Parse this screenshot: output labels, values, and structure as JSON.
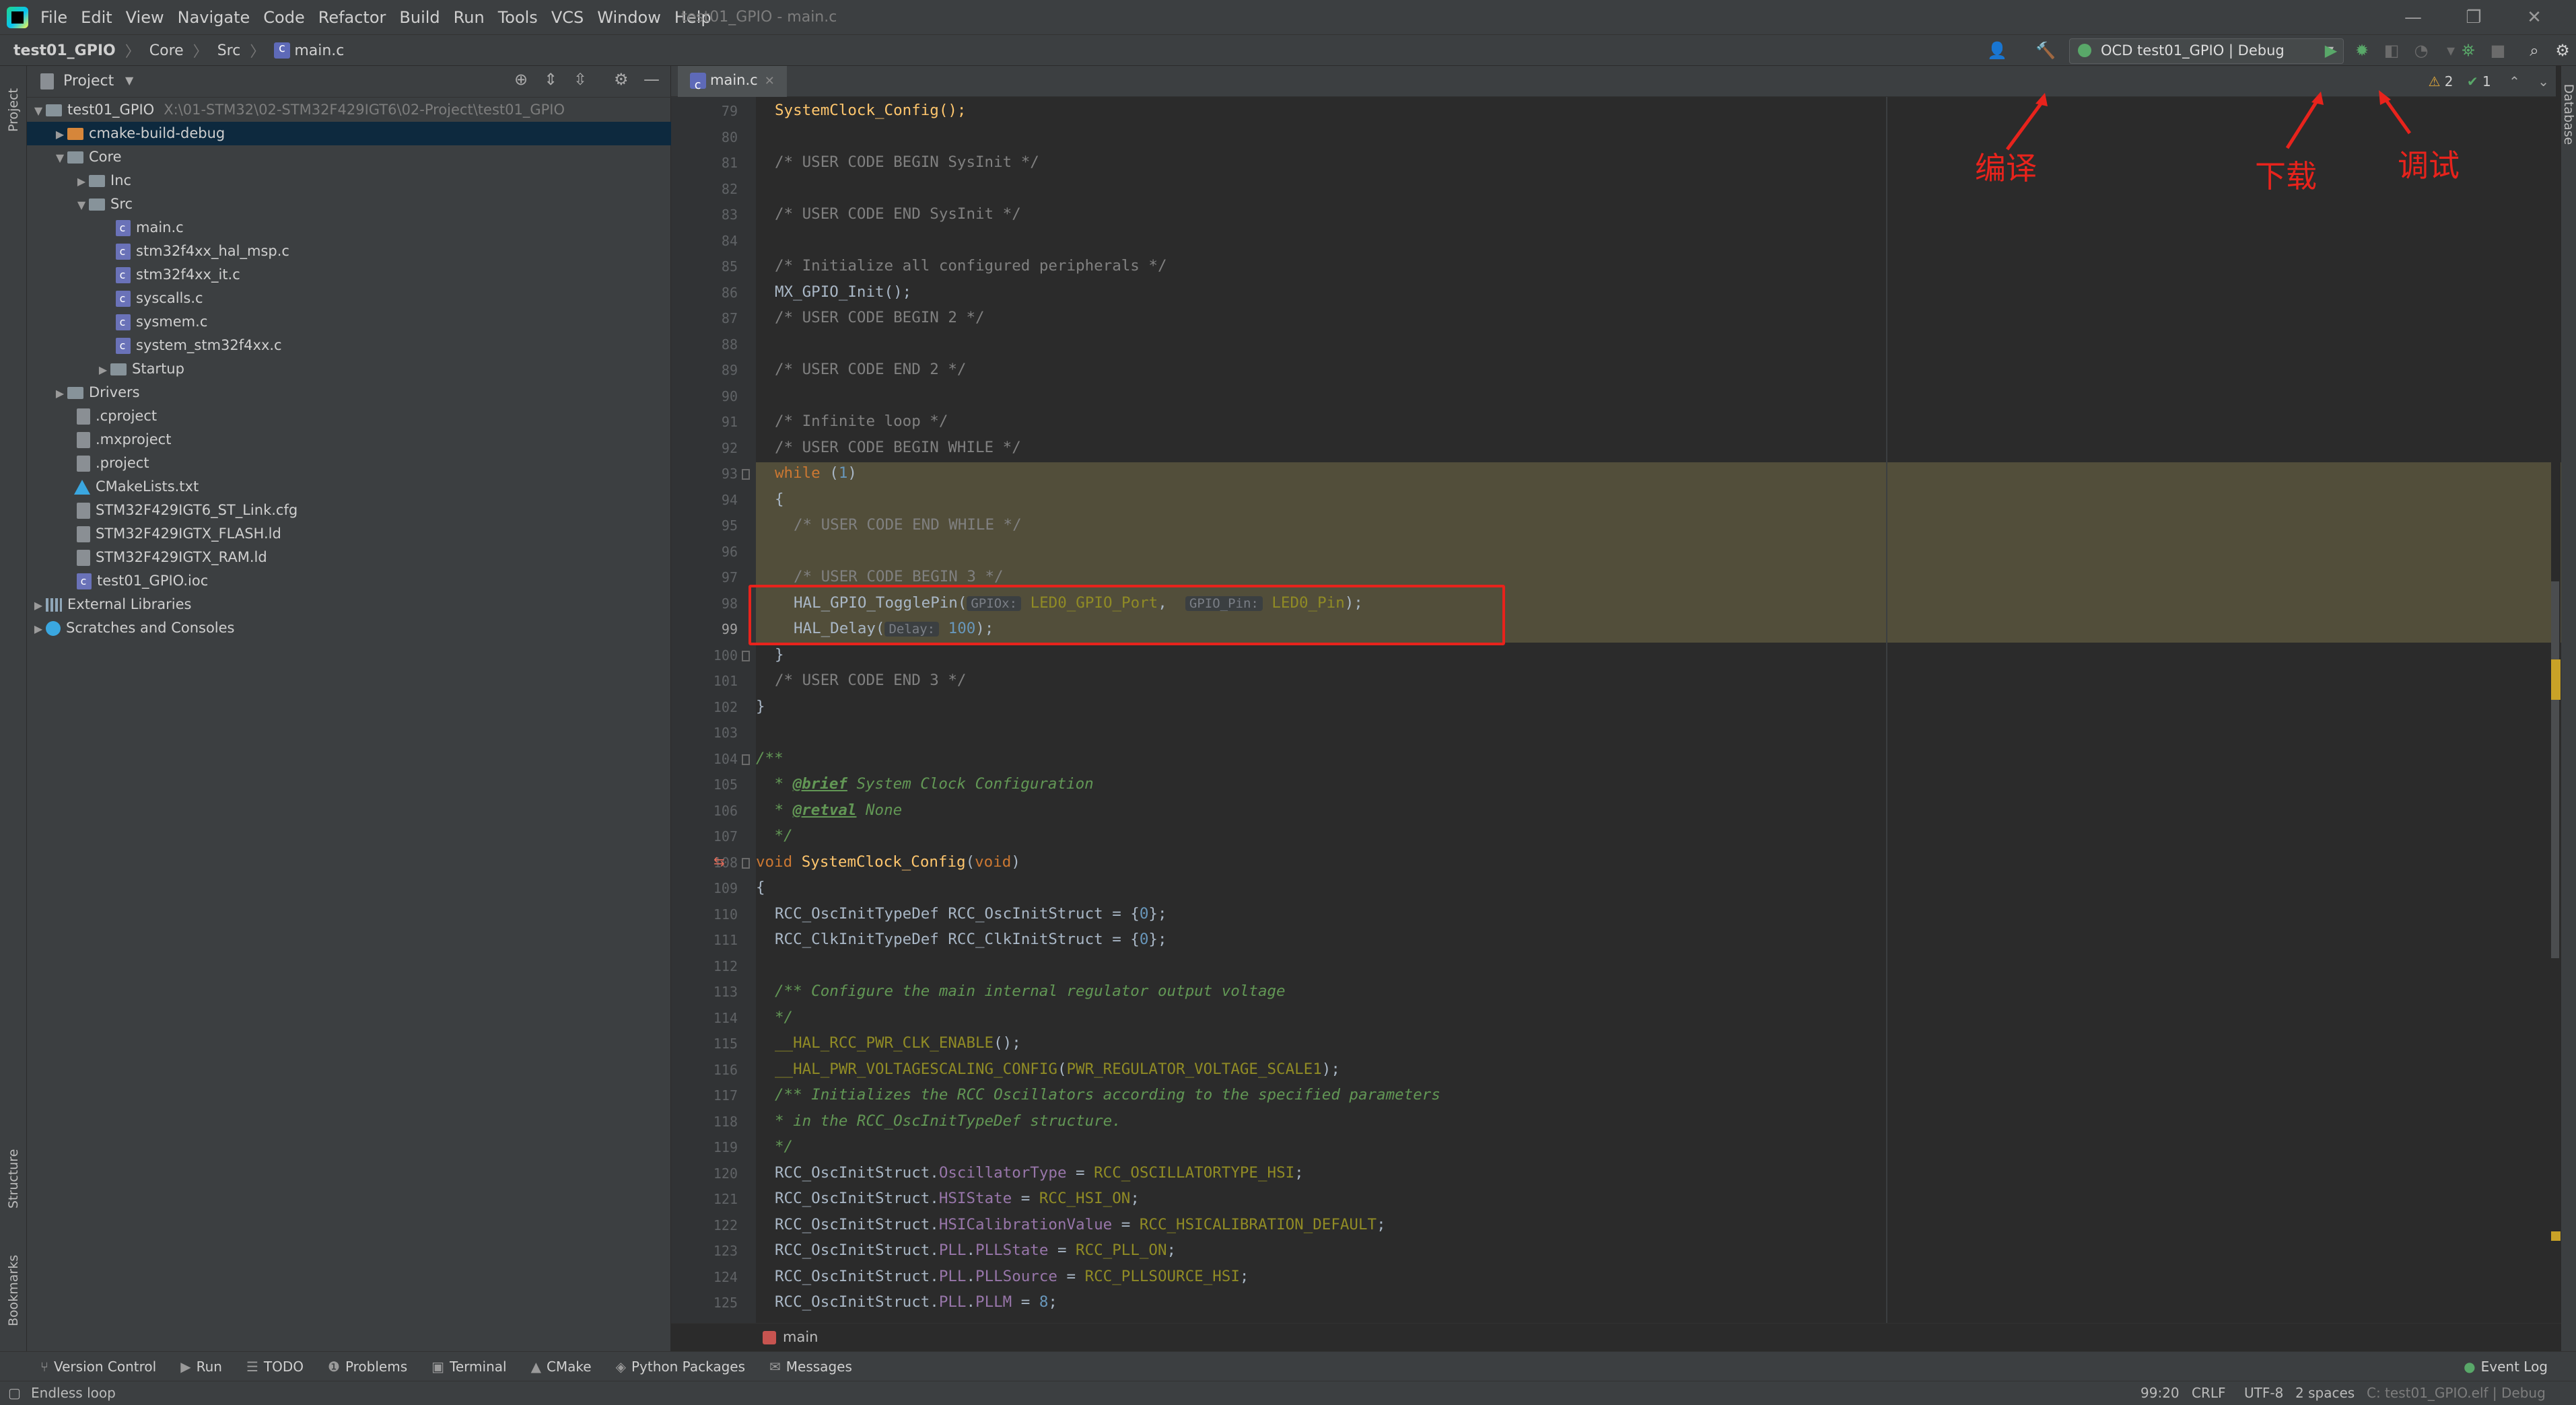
{
  "window": {
    "title": "test01_GPIO - main.c",
    "menu": [
      "File",
      "Edit",
      "View",
      "Navigate",
      "Code",
      "Refactor",
      "Build",
      "Run",
      "Tools",
      "VCS",
      "Window",
      "Help"
    ]
  },
  "navbar": {
    "breadcrumb": [
      "test01_GPIO",
      "Core",
      "Src",
      "main.c"
    ],
    "run_config": "OCD test01_GPIO | Debug"
  },
  "left_strip": {
    "project": "Project",
    "structure": "Structure",
    "bookmarks": "Bookmarks"
  },
  "right_strip": {
    "database": "Database"
  },
  "project_panel": {
    "title": "Project",
    "tree": [
      {
        "label": "test01_GPIO",
        "path": "X:\\01-STM32\\02-STM32F429IGT6\\02-Project\\test01_GPIO"
      },
      {
        "label": "cmake-build-debug"
      },
      {
        "label": "Core"
      },
      {
        "label": "Inc"
      },
      {
        "label": "Src"
      },
      {
        "label": "main.c"
      },
      {
        "label": "stm32f4xx_hal_msp.c"
      },
      {
        "label": "stm32f4xx_it.c"
      },
      {
        "label": "syscalls.c"
      },
      {
        "label": "sysmem.c"
      },
      {
        "label": "system_stm32f4xx.c"
      },
      {
        "label": "Startup"
      },
      {
        "label": "Drivers"
      },
      {
        "label": ".cproject"
      },
      {
        "label": ".mxproject"
      },
      {
        "label": ".project"
      },
      {
        "label": "CMakeLists.txt"
      },
      {
        "label": "STM32F429IGT6_ST_Link.cfg"
      },
      {
        "label": "STM32F429IGTX_FLASH.ld"
      },
      {
        "label": "STM32F429IGTX_RAM.ld"
      },
      {
        "label": "test01_GPIO.ioc"
      },
      {
        "label": "External Libraries"
      },
      {
        "label": "Scratches and Consoles"
      }
    ]
  },
  "editor": {
    "tab": "main.c",
    "inspections": {
      "warnings": "2",
      "ok": "1"
    },
    "line_numbers": [
      "79",
      "80",
      "81",
      "82",
      "83",
      "84",
      "85",
      "86",
      "87",
      "88",
      "89",
      "90",
      "91",
      "92",
      "93",
      "94",
      "95",
      "96",
      "97",
      "98",
      "99",
      "100",
      "101",
      "102",
      "103",
      "104",
      "105",
      "106",
      "107",
      "108",
      "109",
      "110",
      "111",
      "112",
      "113",
      "114",
      "115",
      "116",
      "117",
      "118",
      "119",
      "120",
      "121",
      "122",
      "123",
      "124",
      "125"
    ],
    "code": {
      "l79": "SystemClock_Config();",
      "l81": "/* USER CODE BEGIN SysInit */",
      "l83": "/* USER CODE END SysInit */",
      "l85": "/* Initialize all configured peripherals */",
      "l86": "MX_GPIO_Init();",
      "l87": "/* USER CODE BEGIN 2 */",
      "l89": "/* USER CODE END 2 */",
      "l91": "/* Infinite loop */",
      "l92": "/* USER CODE BEGIN WHILE */",
      "l93_kw": "while",
      "l93_open": " (",
      "l93_num": "1",
      "l93_close": ")",
      "l94": "{",
      "l95": "/* USER CODE END WHILE */",
      "l97": "/* USER CODE BEGIN 3 */",
      "l98_fn": "HAL_GPIO_TogglePin(",
      "l98_hint1": "GPIOx:",
      "l98_arg1": "LED0_GPIO_Port",
      "l98_comma": ", ",
      "l98_hint2": "GPIO_Pin:",
      "l98_arg2": "LED0_Pin",
      "l98_end": ");",
      "l99_fn": "HAL_Delay(",
      "l99_hint": "Delay:",
      "l99_num": "100",
      "l99_end": ");",
      "l100": "}",
      "l101": "/* USER CODE END 3 */",
      "l102": "}",
      "l104": "/**",
      "l105_star": " * ",
      "l105_tag": "@brief",
      "l105_text": " System Clock Configuration",
      "l106_star": " * ",
      "l106_tag": "@retval",
      "l106_text": " None",
      "l107": " */",
      "l108_kw": "void",
      "l108_fn": "SystemClock_Config",
      "l108_open": "(",
      "l108_kw2": "void",
      "l108_close": ")",
      "l109": "{",
      "l110_a": "RCC_OscInitTypeDef RCC_OscInitStruct = {",
      "l110_num": "0",
      "l110_b": "};",
      "l111_a": "RCC_ClkInitTypeDef RCC_ClkInitStruct = {",
      "l111_num": "0",
      "l111_b": "};",
      "l113": "/** Configure the main internal regulator output voltage",
      "l114": "*/",
      "l115": "__HAL_RCC_PWR_CLK_ENABLE",
      "l115_end": "();",
      "l116": "__HAL_PWR_VOLTAGESCALING_CONFIG",
      "l116_open": "(",
      "l116_arg": "PWR_REGULATOR_VOLTAGE_SCALE1",
      "l116_end": ");",
      "l117": "/** Initializes the RCC Oscillators according to the specified parameters",
      "l118": "* in the RCC_OscInitTypeDef structure.",
      "l119": "*/",
      "l120_a": "RCC_OscInitStruct.",
      "l120_f": "OscillatorType",
      "l120_eq": " = ",
      "l120_v": "RCC_OSCILLATORTYPE_HSI",
      "l121_a": "RCC_OscInitStruct.",
      "l121_f": "HSIState",
      "l121_eq": " = ",
      "l121_v": "RCC_HSI_ON",
      "l122_a": "RCC_OscInitStruct.",
      "l122_f": "HSICalibrationValue",
      "l122_eq": " = ",
      "l122_v": "RCC_HSICALIBRATION_DEFAULT",
      "l123_a": "RCC_OscInitStruct.",
      "l123_f1": "PLL",
      "l123_dot": ".",
      "l123_f2": "PLLState",
      "l123_eq": " = ",
      "l123_v": "RCC_PLL_ON",
      "l124_a": "RCC_OscInitStruct.",
      "l124_f1": "PLL",
      "l124_dot": ".",
      "l124_f2": "PLLSource",
      "l124_eq": " = ",
      "l124_v": "RCC_PLLSOURCE_HSI",
      "l125_a": "RCC_OscInitStruct.",
      "l125_f1": "PLL",
      "l125_dot": ".",
      "l125_f2": "PLLM",
      "l125_eq": " = ",
      "l125_num": "8",
      "semi": ";"
    }
  },
  "annotations": {
    "compile": "编译",
    "download": "下载",
    "debug": "调试"
  },
  "bottom_breadcrumb": "main",
  "tool_windows": [
    "Version Control",
    "Run",
    "TODO",
    "Problems",
    "Terminal",
    "CMake",
    "Python Packages",
    "Messages"
  ],
  "event_log": "Event Log",
  "status": {
    "message": "Endless loop",
    "position": "99:20",
    "line_sep": "CRLF",
    "encoding": "UTF-8",
    "indent": "2 spaces",
    "context": "C: test01_GPIO.elf | Debug"
  },
  "colors": {
    "accent_red": "#e8231c",
    "run_green": "#59a869",
    "build_green": "#59a869"
  }
}
